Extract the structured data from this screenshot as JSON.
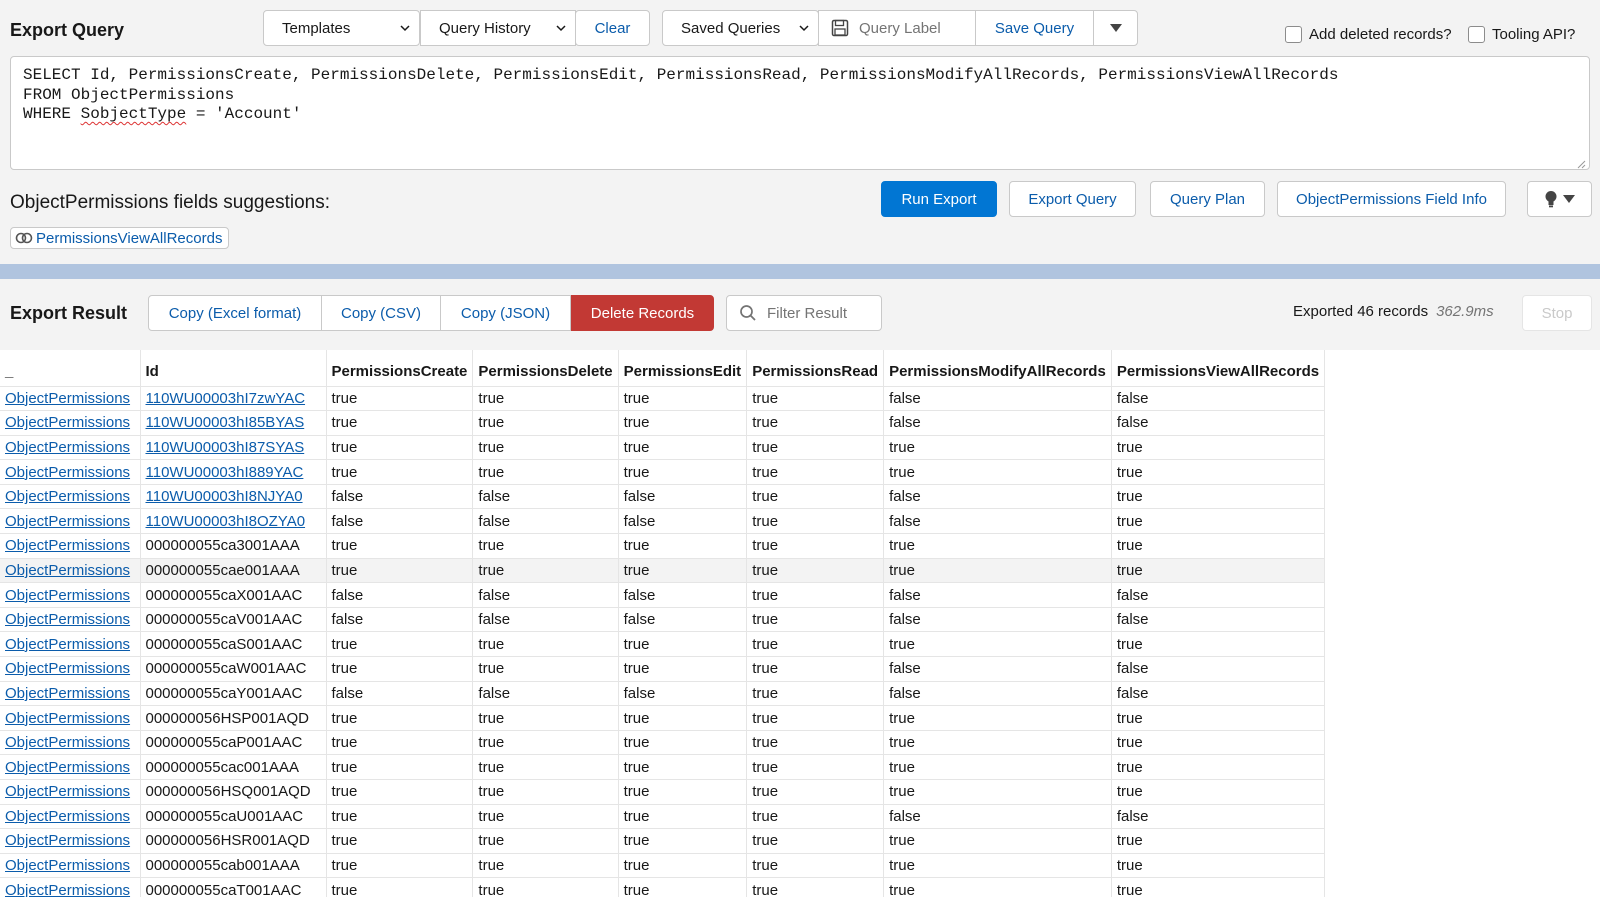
{
  "header": {
    "title": "Export Query",
    "templates_label": "Templates",
    "history_label": "Query History",
    "clear_label": "Clear",
    "saved_label": "Saved Queries",
    "label_placeholder": "Query Label",
    "save_label": "Save Query",
    "deleted_label": "Add deleted records?",
    "tooling_label": "Tooling API?"
  },
  "query": {
    "line1": "SELECT Id, PermissionsCreate, PermissionsDelete, PermissionsEdit, PermissionsRead, PermissionsModifyAllRecords, PermissionsViewAllRecords",
    "line2": "FROM ObjectPermissions",
    "line3_prefix": "WHERE ",
    "line3_token": "SobjectType",
    "line3_suffix": " = 'Account'"
  },
  "suggestions": {
    "title": "ObjectPermissions fields suggestions:",
    "chip": "PermissionsViewAllRecords"
  },
  "actions": {
    "run": "Run Export",
    "export": "Export Query",
    "plan": "Query Plan",
    "info": "ObjectPermissions Field Info"
  },
  "results": {
    "title": "Export Result",
    "copy_excel": "Copy (Excel format)",
    "copy_csv": "Copy (CSV)",
    "copy_json": "Copy (JSON)",
    "delete": "Delete Records",
    "filter_placeholder": "Filter Result",
    "status": "Exported 46 records",
    "time": "362.9ms",
    "stop": "Stop"
  },
  "table": {
    "headers": [
      "_",
      "Id",
      "PermissionsCreate",
      "PermissionsDelete",
      "PermissionsEdit",
      "PermissionsRead",
      "PermissionsModifyAllRecords",
      "PermissionsViewAllRecords"
    ],
    "rows": [
      [
        "ObjectPermissions",
        "110WU00003hI7zwYAC",
        "true",
        "true",
        "true",
        "true",
        "false",
        "false"
      ],
      [
        "ObjectPermissions",
        "110WU00003hI85BYAS",
        "true",
        "true",
        "true",
        "true",
        "false",
        "false"
      ],
      [
        "ObjectPermissions",
        "110WU00003hI87SYAS",
        "true",
        "true",
        "true",
        "true",
        "true",
        "true"
      ],
      [
        "ObjectPermissions",
        "110WU00003hI889YAC",
        "true",
        "true",
        "true",
        "true",
        "true",
        "true"
      ],
      [
        "ObjectPermissions",
        "110WU00003hI8NJYA0",
        "false",
        "false",
        "false",
        "true",
        "false",
        "true"
      ],
      [
        "ObjectPermissions",
        "110WU00003hI8OZYA0",
        "false",
        "false",
        "false",
        "true",
        "false",
        "true"
      ],
      [
        "ObjectPermissions",
        "000000055ca3001AAA",
        "true",
        "true",
        "true",
        "true",
        "true",
        "true"
      ],
      [
        "ObjectPermissions",
        "000000055cae001AAA",
        "true",
        "true",
        "true",
        "true",
        "true",
        "true"
      ],
      [
        "ObjectPermissions",
        "000000055caX001AAC",
        "false",
        "false",
        "false",
        "true",
        "false",
        "false"
      ],
      [
        "ObjectPermissions",
        "000000055caV001AAC",
        "false",
        "false",
        "false",
        "true",
        "false",
        "false"
      ],
      [
        "ObjectPermissions",
        "000000055caS001AAC",
        "true",
        "true",
        "true",
        "true",
        "true",
        "true"
      ],
      [
        "ObjectPermissions",
        "000000055caW001AAC",
        "true",
        "true",
        "true",
        "true",
        "false",
        "false"
      ],
      [
        "ObjectPermissions",
        "000000055caY001AAC",
        "false",
        "false",
        "false",
        "true",
        "false",
        "false"
      ],
      [
        "ObjectPermissions",
        "000000056HSP001AQD",
        "true",
        "true",
        "true",
        "true",
        "true",
        "true"
      ],
      [
        "ObjectPermissions",
        "000000055caP001AAC",
        "true",
        "true",
        "true",
        "true",
        "true",
        "true"
      ],
      [
        "ObjectPermissions",
        "000000055cac001AAA",
        "true",
        "true",
        "true",
        "true",
        "true",
        "true"
      ],
      [
        "ObjectPermissions",
        "000000056HSQ001AQD",
        "true",
        "true",
        "true",
        "true",
        "true",
        "true"
      ],
      [
        "ObjectPermissions",
        "000000055caU001AAC",
        "true",
        "true",
        "true",
        "true",
        "false",
        "false"
      ],
      [
        "ObjectPermissions",
        "000000056HSR001AQD",
        "true",
        "true",
        "true",
        "true",
        "true",
        "true"
      ],
      [
        "ObjectPermissions",
        "000000055cab001AAA",
        "true",
        "true",
        "true",
        "true",
        "true",
        "true"
      ],
      [
        "ObjectPermissions",
        "000000055caT001AAC",
        "true",
        "true",
        "true",
        "true",
        "true",
        "true"
      ]
    ]
  },
  "colors": {
    "brand_blue": "#0176d3",
    "link_blue": "#0b5cab",
    "delete_red": "#c23934",
    "divider": "#b0c4df"
  },
  "icons": {
    "templates_chevron": "chevron-down-icon",
    "save": "floppy-disk-icon",
    "search": "search-icon",
    "bulb": "lightbulb-icon",
    "chip": "link-icon"
  }
}
